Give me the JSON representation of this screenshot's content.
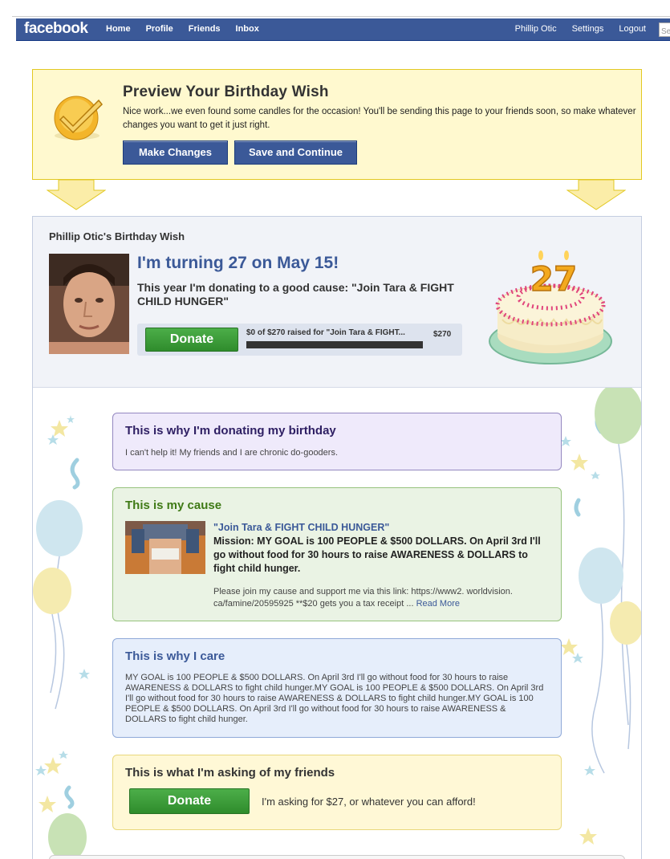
{
  "navbar": {
    "logo": "facebook",
    "links": [
      "Home",
      "Profile",
      "Friends",
      "Inbox"
    ],
    "user": "Phillip Otic",
    "settings": "Settings",
    "logout": "Logout",
    "search_placeholder": "Se"
  },
  "preview": {
    "title": "Preview Your Birthday Wish",
    "text": "Nice work...we even found some candles for the occasion! You'll be sending this page to your friends soon, so make whatever changes you want to get it just right.",
    "make_changes": "Make Changes",
    "save_continue": "Save and Continue"
  },
  "wish": {
    "owner_title": "Phillip Otic's Birthday Wish",
    "turning": "I'm turning 27 on May 15!",
    "cause_line": "This year I'm donating to a good cause: \"Join Tara & FIGHT CHILD HUNGER\"",
    "donate_label": "Donate",
    "raised_text": "$0 of $270 raised for \"Join Tara & FIGHT...",
    "goal": "$270",
    "progress_fraction": 0,
    "cake_number": "27"
  },
  "why_donating": {
    "title": "This is why I'm donating my birthday",
    "text": "I can't help it! My friends and I are chronic do-gooders."
  },
  "cause": {
    "title": "This is my cause",
    "name": "\"Join Tara & FIGHT CHILD HUNGER\"",
    "mission": "Mission: MY GOAL is 100 PEOPLE & $500 DOLLARS. On April 3rd I'll go without food for 30 hours to raise AWARENESS & DOLLARS to fight child hunger.",
    "description": "Please join my cause and support me via this link: https://www2. worldvision. ca/famine/20595925 **$20 gets you a tax receipt ... ",
    "read_more": "Read More"
  },
  "care": {
    "title": "This is why I care",
    "text": "MY GOAL is 100 PEOPLE & $500 DOLLARS. On April 3rd I'll go without food for 30 hours to raise AWARENESS & DOLLARS to fight child hunger.MY GOAL is 100 PEOPLE & $500 DOLLARS. On April 3rd I'll go without food for 30 hours to raise AWARENESS & DOLLARS to fight child hunger.MY GOAL is 100 PEOPLE & $500 DOLLARS. On April 3rd I'll go without food for 30 hours to raise AWARENESS & DOLLARS to fight child hunger."
  },
  "ask": {
    "title": "This is what I'm asking of my friends",
    "donate_label": "Donate",
    "text": "I'm asking for $27, or whatever you can afford!"
  },
  "colors": {
    "brand": "#3b5998",
    "donate_green": "#3a9a36",
    "preview_bg": "#fff9cf"
  }
}
